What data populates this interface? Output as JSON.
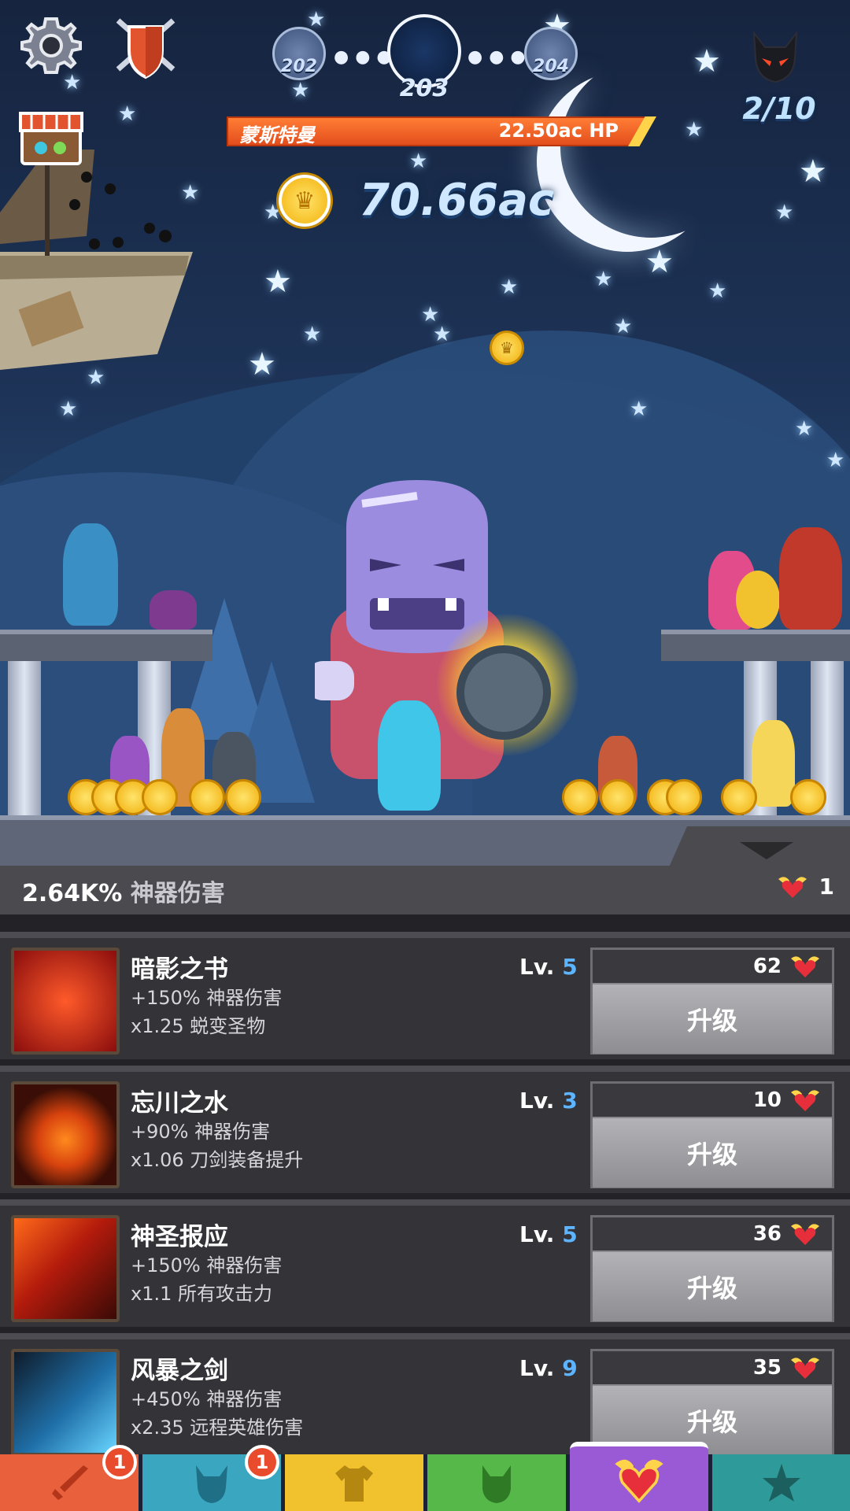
{
  "hud": {
    "stages": {
      "previous": "202",
      "current": "203",
      "next": "204"
    },
    "boss_bar": {
      "name": "蒙斯特曼",
      "hp": "22.50ac HP"
    },
    "gold": "70.66ac",
    "kills": "2/10"
  },
  "panel": {
    "header_value": "2.64K%",
    "header_label": "神器伤害",
    "relic_count": "1"
  },
  "artifacts": [
    {
      "name": "暗影之书",
      "effect": "+150% 神器伤害",
      "bonus": "x1.25 蜕变圣物",
      "level_prefix": "Lv.",
      "level": "5",
      "cost": "62",
      "button": "升级",
      "icon": "shadow-book-icon"
    },
    {
      "name": "忘川之水",
      "effect": "+90% 神器伤害",
      "bonus": "x1.06 刀剑装备提升",
      "level_prefix": "Lv.",
      "level": "3",
      "cost": "10",
      "button": "升级",
      "icon": "lethe-water-icon"
    },
    {
      "name": "神圣报应",
      "effect": "+150% 神器伤害",
      "bonus": "x1.1 所有攻击力",
      "level_prefix": "Lv.",
      "level": "5",
      "cost": "36",
      "button": "升级",
      "icon": "divine-retribution-icon"
    },
    {
      "name": "风暴之剑",
      "effect": "+450% 神器伤害",
      "bonus": "x2.35 远程英雄伤害",
      "level_prefix": "Lv.",
      "level": "9",
      "cost": "35",
      "button": "升级",
      "icon": "storm-sword-icon"
    }
  ],
  "tabs": [
    {
      "icon": "sword-icon",
      "color": "#e8603c",
      "badge": "1"
    },
    {
      "icon": "hero-helmet-icon",
      "color": "#3aa6bf",
      "badge": "1"
    },
    {
      "icon": "armor-shirt-icon",
      "color": "#f2c12e",
      "badge": ""
    },
    {
      "icon": "pet-icon",
      "color": "#57b84a",
      "badge": ""
    },
    {
      "icon": "winged-heart-icon",
      "color": "#9a5ad6",
      "badge": ""
    },
    {
      "icon": "star-icon",
      "color": "#2f9a9a",
      "badge": ""
    }
  ],
  "colors": {
    "level_number": "#5db4ff",
    "hp_bar": "#f0652b",
    "gold": "#f3b10c"
  }
}
